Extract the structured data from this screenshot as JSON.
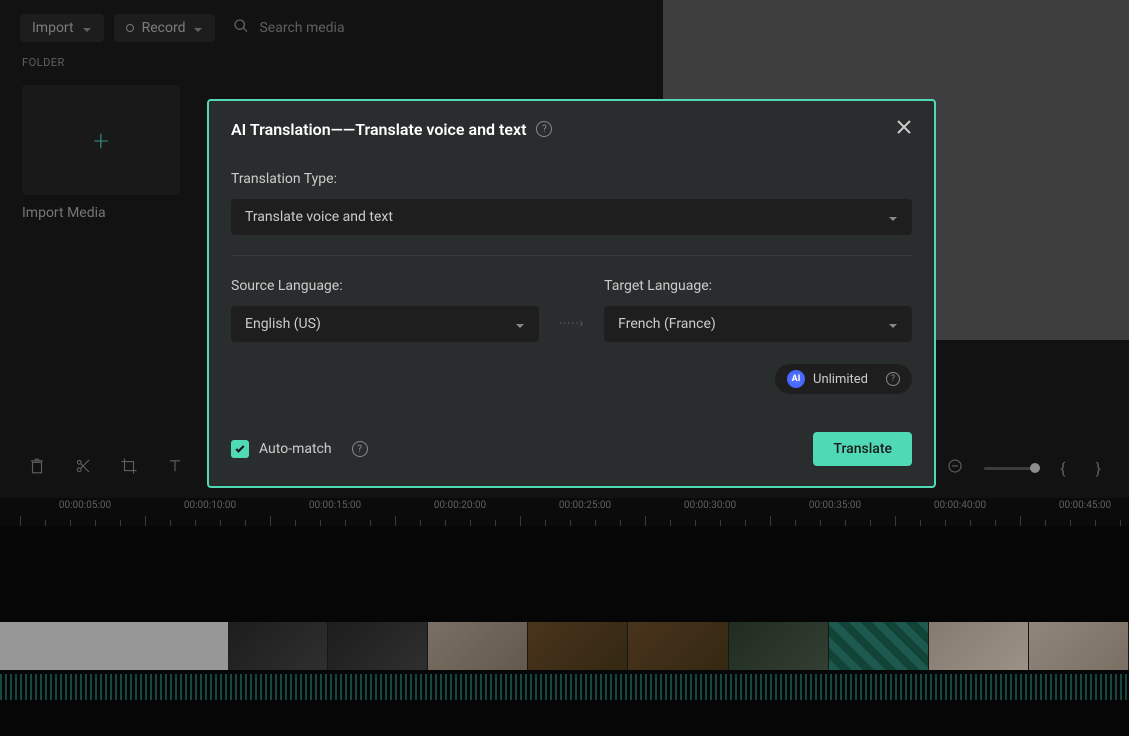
{
  "topbar": {
    "import_label": "Import",
    "record_label": "Record",
    "search_placeholder": "Search media"
  },
  "folder": {
    "section_label": "FOLDER",
    "import_tile_label": "Import Media"
  },
  "modal": {
    "title": "AI Translation——Translate voice and text",
    "translation_type_label": "Translation Type:",
    "translation_type_value": "Translate voice and text",
    "source_label": "Source Language:",
    "source_value": "English (US)",
    "target_label": "Target Language:",
    "target_value": "French (France)",
    "unlimited_label": "Unlimited",
    "ai_badge": "AI",
    "auto_match_label": "Auto-match",
    "translate_button": "Translate"
  },
  "timeline": {
    "labels": [
      "00:00:05:00",
      "00:00:10:00",
      "00:00:15:00",
      "00:00:20:00",
      "00:00:25:00",
      "00:00:30:00",
      "00:00:35:00",
      "00:00:40:00",
      "00:00:45:00"
    ]
  },
  "colors": {
    "accent": "#50d9b5"
  }
}
